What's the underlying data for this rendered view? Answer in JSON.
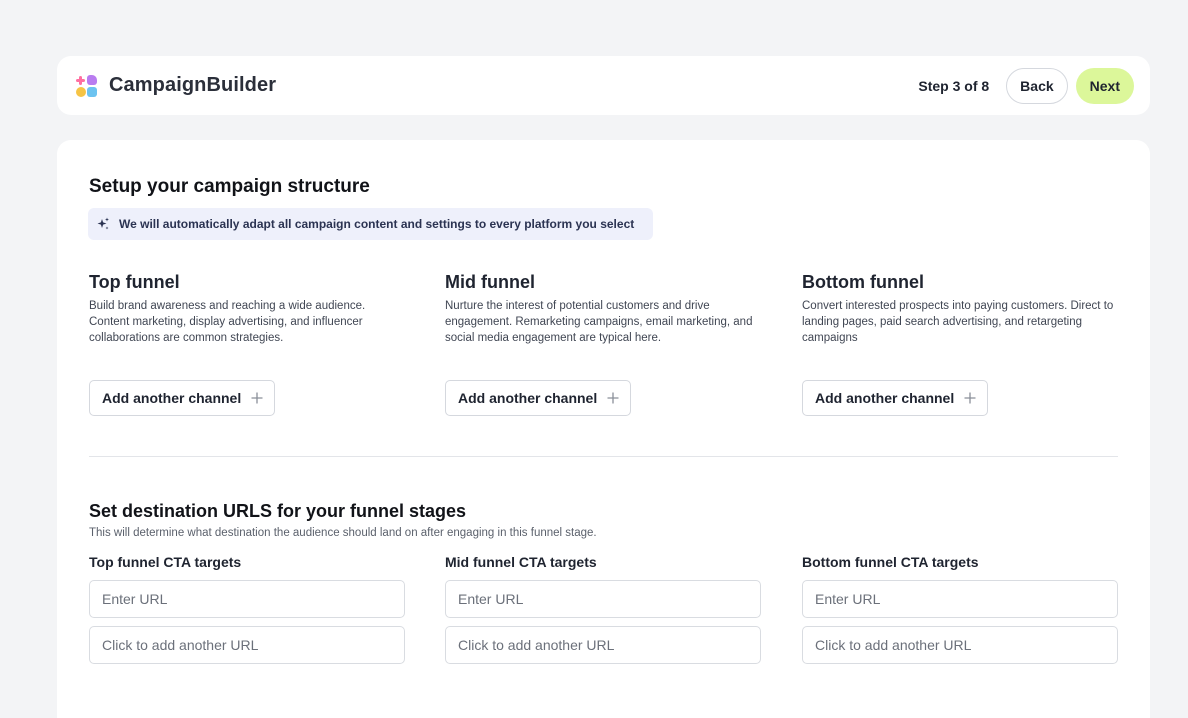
{
  "header": {
    "brand_name": "CampaignBuilder",
    "step_text": "Step 3 of 8",
    "back_label": "Back",
    "next_label": "Next"
  },
  "structure": {
    "title": "Setup your campaign structure",
    "info_text": "We will automatically adapt all campaign content and settings to every platform you select",
    "funnels": [
      {
        "title": "Top funnel",
        "description": "Build brand awareness and reaching a wide audience. Content marketing, display advertising, and influencer collaborations are common strategies.",
        "add_label": "Add another channel"
      },
      {
        "title": "Mid funnel",
        "description": "Nurture the interest of potential customers and drive engagement. Remarketing campaigns, email marketing, and social media engagement are typical here.",
        "add_label": "Add another channel"
      },
      {
        "title": "Bottom funnel",
        "description": "Convert interested prospects into paying customers. Direct to landing pages, paid search advertising, and retargeting campaigns",
        "add_label": "Add another channel"
      }
    ]
  },
  "destinations": {
    "title": "Set destination URLS for your funnel stages",
    "subtitle": "This will determine what destination the audience should land on after engaging in this funnel stage.",
    "targets": [
      {
        "label": "Top funnel CTA targets",
        "url_placeholder": "Enter URL",
        "add_placeholder": "Click to add another URL"
      },
      {
        "label": "Mid funnel CTA targets",
        "url_placeholder": "Enter URL",
        "add_placeholder": "Click to add another URL"
      },
      {
        "label": "Bottom funnel CTA targets",
        "url_placeholder": "Enter URL",
        "add_placeholder": "Click to add another URL"
      }
    ]
  },
  "icons": {
    "logo": "campaignbuilder-logo",
    "sparkle": "sparkle-icon",
    "plus": "plus-icon"
  },
  "colors": {
    "accent_next": "#dcf79a",
    "info_banner_bg": "#eef0fb",
    "page_bg": "#f3f4f6"
  }
}
